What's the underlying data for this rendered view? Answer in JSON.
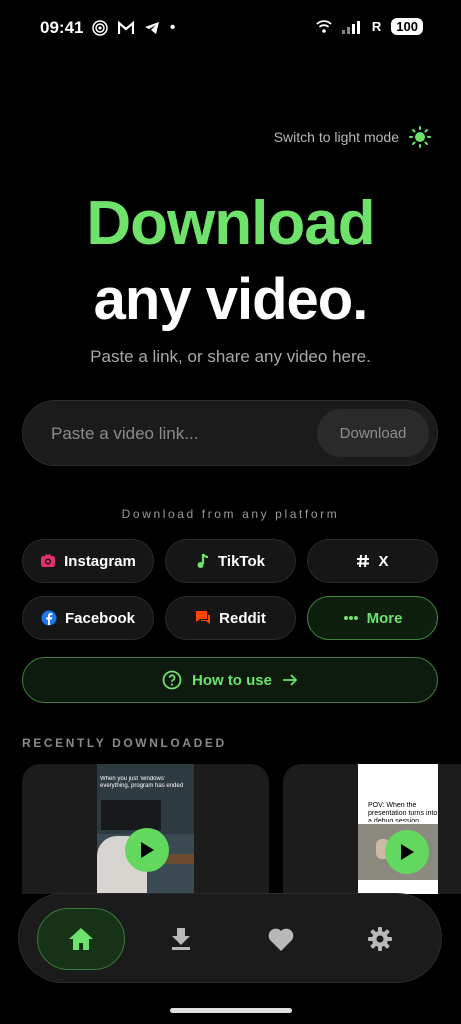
{
  "status": {
    "time": "09:41",
    "battery": "100",
    "network": "R"
  },
  "theme_toggle": {
    "label": "Switch to light mode",
    "icon": "sun-icon"
  },
  "hero": {
    "line1": "Download",
    "line2": "any video.",
    "subtitle": "Paste a link, or share any video here."
  },
  "input": {
    "placeholder": "Paste a video link...",
    "value": "",
    "button": "Download"
  },
  "platforms": {
    "label": "Download from any platform",
    "items": [
      {
        "label": "Instagram",
        "icon": "instagram-icon",
        "color": "#e1306c"
      },
      {
        "label": "TikTok",
        "icon": "tiktok-note-icon",
        "color": "#6ee26a"
      },
      {
        "label": "X",
        "icon": "hash-icon",
        "color": "#ffffff"
      },
      {
        "label": "Facebook",
        "icon": "facebook-icon",
        "color": "#1877f2"
      },
      {
        "label": "Reddit",
        "icon": "reddit-chat-icon",
        "color": "#ff4500"
      },
      {
        "label": "More",
        "icon": "more-dots-icon",
        "color": "#6ee26a"
      }
    ]
  },
  "how_to": {
    "label": "How to use"
  },
  "recent": {
    "label": "RECENTLY DOWNLOADED",
    "items": [
      {
        "caption": "When you just 'windows' everything, program has ended"
      },
      {
        "caption": "POV: When the presentation turns into a debug session"
      }
    ]
  },
  "nav": {
    "items": [
      {
        "name": "home",
        "icon": "home-icon",
        "active": true
      },
      {
        "name": "downloads",
        "icon": "download-icon",
        "active": false
      },
      {
        "name": "favorites",
        "icon": "heart-icon",
        "active": false
      },
      {
        "name": "settings",
        "icon": "gear-icon",
        "active": false
      }
    ]
  },
  "colors": {
    "accent": "#6ee26a",
    "background": "#000000"
  }
}
